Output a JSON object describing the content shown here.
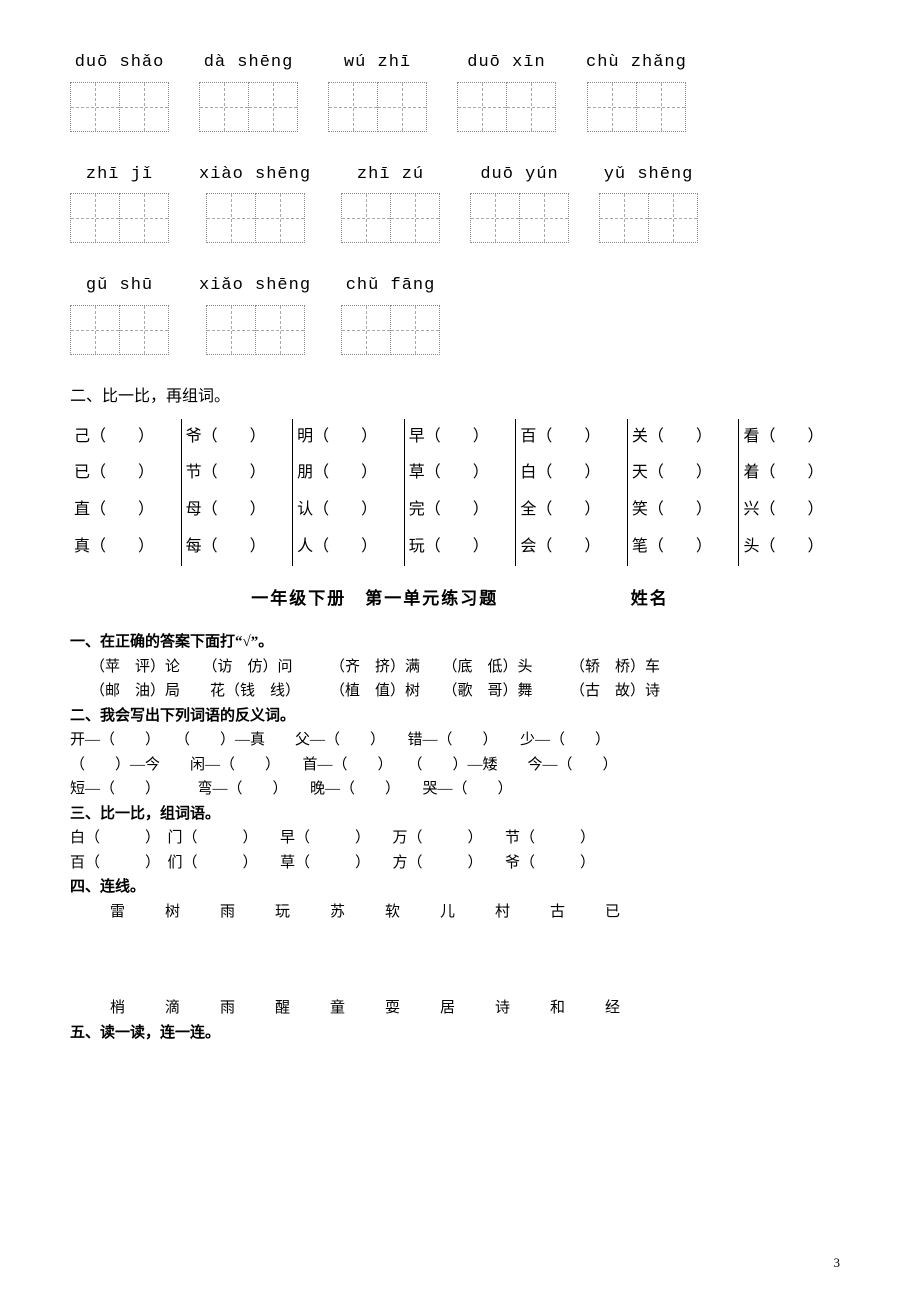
{
  "rows": [
    [
      {
        "py": "duō shǎo",
        "n": 2
      },
      {
        "py": "dà shēng",
        "n": 2
      },
      {
        "py": "wú zhī",
        "n": 2
      },
      {
        "py": "duō xīn",
        "n": 2
      },
      {
        "py": "chù zhǎng",
        "n": 2
      }
    ],
    [
      {
        "py": "zhī jǐ",
        "n": 2
      },
      {
        "py": "xiào shēng",
        "n": 2
      },
      {
        "py": "zhī zú",
        "n": 2
      },
      {
        "py": "duō yún",
        "n": 2
      },
      {
        "py": "yǔ shēng",
        "n": 2
      }
    ],
    [
      {
        "py": "gǔ shū",
        "n": 2
      },
      {
        "py": "xiǎo shēng",
        "n": 2
      },
      {
        "py": "chǔ fāng",
        "n": 2
      }
    ]
  ],
  "sec2_title": "二、比一比，再组词。",
  "grid": [
    [
      "己（　　）",
      "爷（　　）",
      "明（　　）",
      "早（　　）",
      "百（　　）",
      "关（　　）",
      "看（　　）"
    ],
    [
      "已（　　）",
      "节（　　）",
      "朋（　　）",
      "草（　　）",
      "白（　　）",
      "天（　　）",
      "着（　　）"
    ],
    [
      "直（　　）",
      "母（　　）",
      "认（　　）",
      "完（　　）",
      "全（　　）",
      "笑（　　）",
      "兴（　　）"
    ],
    [
      "真（　　）",
      "每（　　）",
      "人（　　）",
      "玩（　　）",
      "会（　　）",
      "笔（　　）",
      "头（　　）"
    ]
  ],
  "title2": "一年级下册　第一单元练习题",
  "name_label": "姓名",
  "q1_title": "一、在正确的答案下面打“√”。",
  "q1_lines": [
    "（苹　评）论　　（访　仿）问　　　（齐　挤）满　　（底　低）头　　　（轿　桥）车",
    "（邮　油）局　　花（钱　线）　　　（植　值）树　　（歌　哥）舞　　　（古　故）诗"
  ],
  "q2_title": "二、我会写出下列词语的反义词。",
  "q2_lines": [
    "开—（　　）　　（　　）—真　　父—（　　）　　错—（　　）　　少—（　　）",
    "（　　）—今　　闲—（　　）　　首—（　　）　　（　　）—矮　　今—（　　）",
    "短—（　　）　　　弯—（　　）　　晚—（　　）　　哭—（　　）"
  ],
  "q3_title": "三、比一比，组词语。",
  "q3_lines": [
    "白（　　　）　门（　　　）　　早（　　　）　　万（　　　）　　节（　　　）",
    "百（　　　）　们（　　　）　　草（　　　）　　方（　　　）　　爷（　　　）"
  ],
  "q4_title": "四、连线。",
  "q4_top": [
    "雷",
    "树",
    "雨",
    "玩",
    "苏",
    "软",
    "儿",
    "村",
    "古",
    "已"
  ],
  "q4_bot": [
    "梢",
    "滴",
    "雨",
    "醒",
    "童",
    "耍",
    "居",
    "诗",
    "和",
    "经"
  ],
  "q5_title": "五、读一读，连一连。",
  "page": "3"
}
